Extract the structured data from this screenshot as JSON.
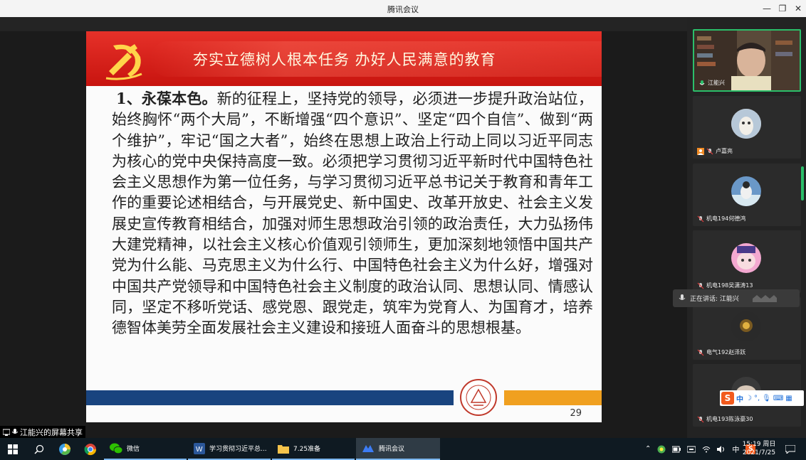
{
  "window": {
    "title": "腾讯会议"
  },
  "slide": {
    "title": "夯实立德树人根本任务    办好人民满意的教育",
    "heading": "1、永葆本色。",
    "body": "新的征程上，坚持党的领导，必须进一步提升政治站位，始终胸怀“两个大局”，不断增强“四个意识”、坚定“四个自信”、做到“两个维护”，牢记“国之大者”，始终在思想上政治上行动上同以习近平同志为核心的党中央保持高度一致。必须把学习贯彻习近平新时代中国特色社会主义思想作为第一位任务，与学习贯彻习近平总书记关于教育和青年工作的重要论述相结合，与开展党史、新中国史、改革开放史、社会主义发展史宣传教育相结合，加强对师生思想政治引领的政治责任，大力弘扬伟大建党精神，以社会主义核心价值观引领师生，更加深刻地领悟中国共产党为什么能、马克思主义为什么行、中国特色社会主义为什么好，增强对中国共产党领导和中国特色社会主义制度的政治认同、思想认同、情感认同，坚定不移听党话、感党恩、跟党走，筑牢为党育人、为国育才，培养德智体美劳全面发展社会主义建设和接班人面奋斗的思想根基。",
    "page_number": "29",
    "colors": {
      "header_red": "#d81e17",
      "bar_blue": "#19447f",
      "bar_orange": "#f0a020"
    }
  },
  "participants": [
    {
      "name": "江能兴",
      "icon": "mic-on-icon",
      "active": true
    },
    {
      "name": "卢嘉亮",
      "icon": "user-badge-icon"
    },
    {
      "name": "机电194何德鸿",
      "icon": "mic-off-icon"
    },
    {
      "name": "机电198吴潇涛13",
      "icon": "mic-off-icon"
    },
    {
      "name": "电气192赵泽跃",
      "icon": "mic-off-icon"
    },
    {
      "name": "机电193陈泳豪30",
      "icon": "mic-off-icon"
    }
  ],
  "speaking": {
    "label": "正在讲话: 江能兴"
  },
  "share_label": "江能兴的屏幕共享",
  "ime": {
    "mode": "中",
    "items": [
      "☽",
      "°,",
      "🎙",
      "⌨",
      "▦"
    ]
  },
  "taskbar": {
    "apps": [
      {
        "label": "微信",
        "icon": "wechat-icon"
      },
      {
        "label": "学习贯彻习近平总...",
        "icon": "word-icon"
      },
      {
        "label": "7.25准备",
        "icon": "folder-icon"
      },
      {
        "label": "腾讯会议",
        "icon": "tencent-meeting-icon"
      }
    ],
    "input_mode": "中",
    "time": "15:19 周日",
    "date": "2021/7/25"
  }
}
